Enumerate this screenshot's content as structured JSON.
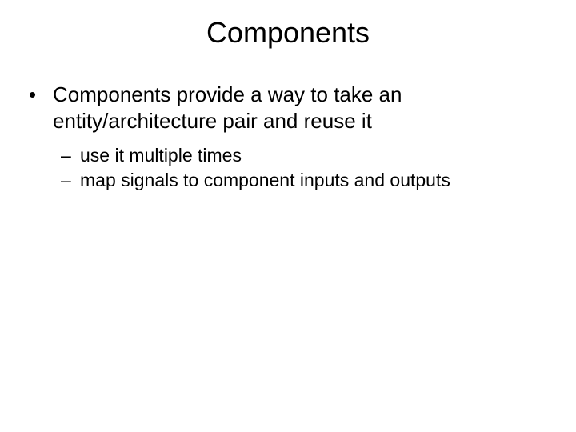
{
  "title": "Components",
  "bullets": [
    {
      "text": "Components provide a way to take an entity/architecture pair and reuse it",
      "sub": [
        "use it multiple times",
        "map signals to component inputs and outputs"
      ]
    }
  ]
}
